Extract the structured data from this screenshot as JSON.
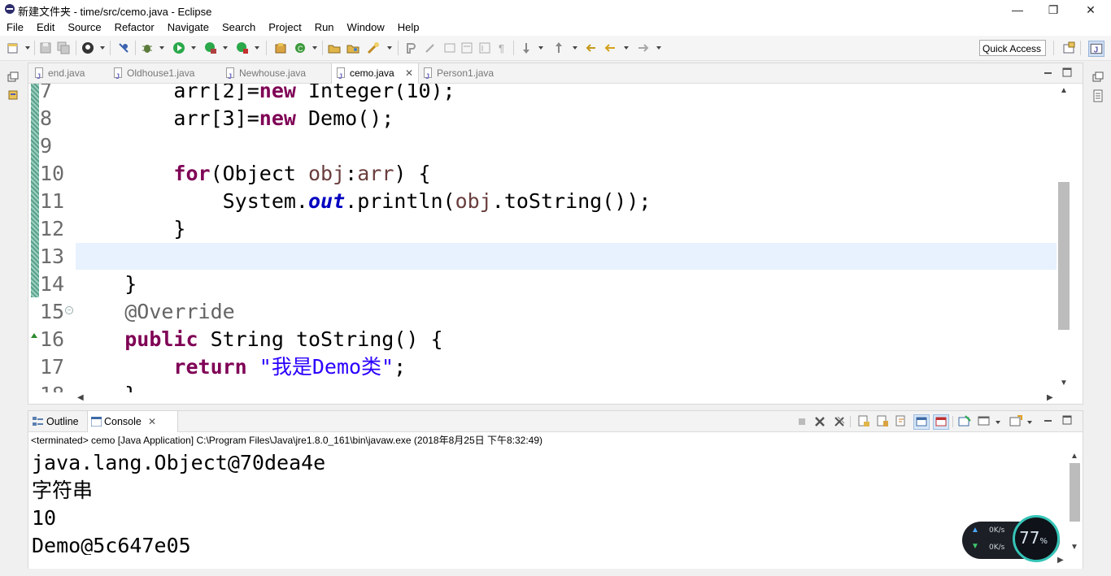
{
  "window": {
    "title": "新建文件夹 - time/src/cemo.java - Eclipse",
    "controls": {
      "minimize": "—",
      "maximize": "❐",
      "close": "✕"
    }
  },
  "menu": [
    "File",
    "Edit",
    "Source",
    "Refactor",
    "Navigate",
    "Search",
    "Project",
    "Run",
    "Window",
    "Help"
  ],
  "toolbar": {
    "quick_access": "Quick Access"
  },
  "editor": {
    "tabs": [
      {
        "label": "end.java",
        "active": false
      },
      {
        "label": "Oldhouse1.java",
        "active": false
      },
      {
        "label": "Newhouse.java",
        "active": false
      },
      {
        "label": "cemo.java",
        "active": true
      },
      {
        "label": "Person1.java",
        "active": false
      }
    ],
    "lines": [
      {
        "num": "7",
        "code": [
          {
            "t": "        arr[2]="
          },
          {
            "t": "new",
            "c": "kw"
          },
          {
            "t": " Integer(10);"
          }
        ]
      },
      {
        "num": "8",
        "code": [
          {
            "t": "        arr[3]="
          },
          {
            "t": "new",
            "c": "kw"
          },
          {
            "t": " Demo();"
          }
        ]
      },
      {
        "num": "9",
        "code": []
      },
      {
        "num": "10",
        "code": [
          {
            "t": "        "
          },
          {
            "t": "for",
            "c": "kw"
          },
          {
            "t": "(Object "
          },
          {
            "t": "obj",
            "c": "var"
          },
          {
            "t": ":"
          },
          {
            "t": "arr",
            "c": "var"
          },
          {
            "t": ") {"
          }
        ]
      },
      {
        "num": "11",
        "code": [
          {
            "t": "            System."
          },
          {
            "t": "out",
            "c": "field"
          },
          {
            "t": ".println("
          },
          {
            "t": "obj",
            "c": "var"
          },
          {
            "t": ".toString());"
          }
        ]
      },
      {
        "num": "12",
        "code": [
          {
            "t": "        }"
          }
        ]
      },
      {
        "num": "13",
        "code": []
      },
      {
        "num": "14",
        "code": [
          {
            "t": "    }"
          }
        ]
      },
      {
        "num": "15",
        "code": [
          {
            "t": "    "
          },
          {
            "t": "@Override",
            "c": "ann"
          }
        ]
      },
      {
        "num": "16",
        "code": [
          {
            "t": "    "
          },
          {
            "t": "public",
            "c": "kw"
          },
          {
            "t": " String toString() {"
          }
        ]
      },
      {
        "num": "17",
        "code": [
          {
            "t": "        "
          },
          {
            "t": "return",
            "c": "kw"
          },
          {
            "t": " "
          },
          {
            "t": "\"我是Demo类\"",
            "c": "str"
          },
          {
            "t": ";"
          }
        ]
      },
      {
        "num": "18",
        "code": [
          {
            "t": "    }"
          }
        ]
      }
    ]
  },
  "console": {
    "tabs": [
      {
        "label": "Outline"
      },
      {
        "label": "Console"
      }
    ],
    "status": "<terminated> cemo [Java Application] C:\\Program Files\\Java\\jre1.8.0_161\\bin\\javaw.exe (2018年8月25日 下午8:32:49)",
    "output": [
      "java.lang.Object@70dea4e",
      "字符串",
      "10",
      "Demo@5c647e05"
    ]
  },
  "net_widget": {
    "up": "0K/s",
    "down": "0K/s",
    "percent": "77",
    "percent_sign": "%"
  }
}
